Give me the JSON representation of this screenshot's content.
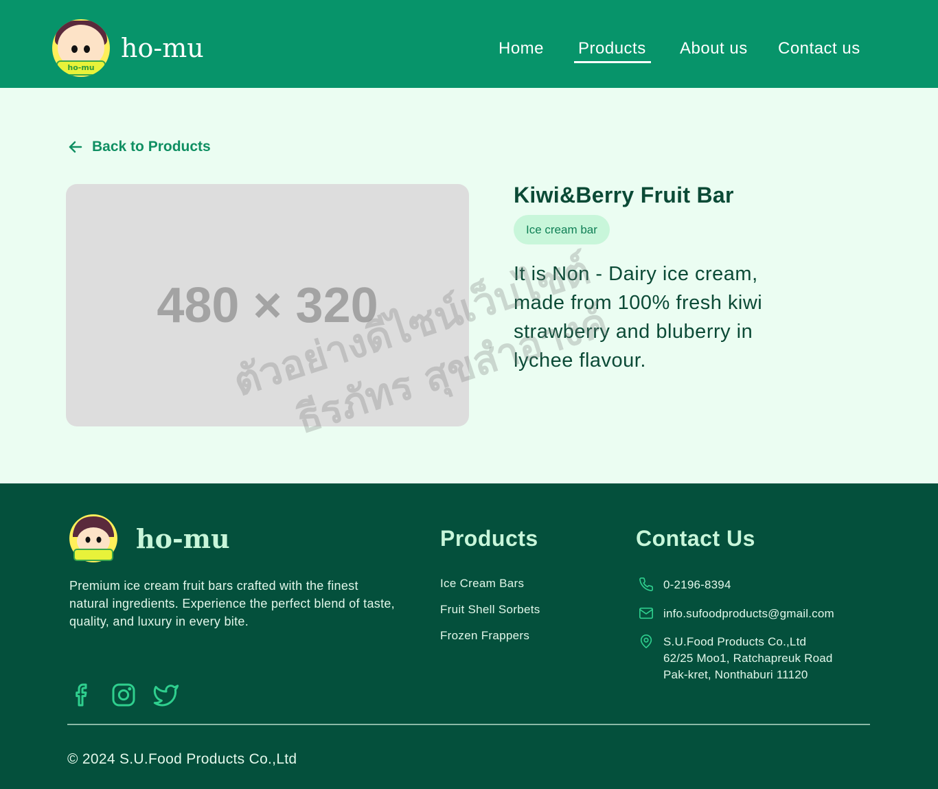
{
  "header": {
    "brand_name": "ho-mu",
    "logo_badge_text": "ho-mu",
    "nav": [
      {
        "label": "Home"
      },
      {
        "label": "Products"
      },
      {
        "label": "About us"
      },
      {
        "label": "Contact us"
      }
    ],
    "active_nav": "Products"
  },
  "main": {
    "back_label": "Back to Products",
    "image_placeholder": "480 × 320",
    "product_title": "Kiwi&Berry Fruit Bar",
    "category": "Ice cream bar",
    "description": "It is Non - Dairy ice cream, made from 100% fresh kiwi strawberry and bluberry in lychee flavour.",
    "watermark_line1": "ตัวอย่างดีไซน์เว็บไซต์",
    "watermark_line2": "ธีรภัทร สุขสำอางค์"
  },
  "footer": {
    "brand_name": "ho-mu",
    "description": "Premium ice cream fruit bars crafted with the finest natural ingredients. Experience the perfect blend of taste, quality, and luxury in every bite.",
    "social": [
      "facebook-icon",
      "instagram-icon",
      "twitter-icon"
    ],
    "products_title": "Products",
    "products_links": [
      "Ice Cream Bars",
      "Fruit Shell Sorbets",
      "Frozen Frappers"
    ],
    "contact_title": "Contact Us",
    "phone": "0-2196-8394",
    "email": "info.sufoodproducts@gmail.com",
    "address_line1": "S.U.Food Products Co.,Ltd",
    "address_line2": "62/25 Moo1, Ratchapreuk Road",
    "address_line3": "Pak-kret, Nonthaburi 11120",
    "copyright": "© 2024 S.U.Food Products Co.,Ltd"
  },
  "colors": {
    "header_bg": "#07946a",
    "page_bg": "#ebfdf2",
    "footer_bg": "#04503c",
    "accent": "#0f8f62"
  }
}
